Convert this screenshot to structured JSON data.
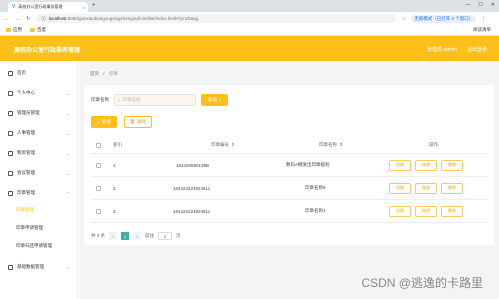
{
  "browser": {
    "tab_title": "高校办公室行政事务管理",
    "url_host": "localhost",
    "url_path": ":8080/gaoxiaobangongxingzheng/admin/dist/index.html#/yinzhang",
    "profile": "无痕模式（已打开 2 个窗口）",
    "bookmarks": [
      "应用",
      "百度"
    ],
    "bookmarks_right": "阅读清单"
  },
  "header": {
    "title": "高校办公室行政事务管理",
    "user": "管理员 admin",
    "logout": "退出登录"
  },
  "sidebar": {
    "items": [
      {
        "label": "首页"
      },
      {
        "label": "个人中心"
      },
      {
        "label": "管理员管理"
      },
      {
        "label": "人事管理"
      },
      {
        "label": "物资管理"
      },
      {
        "label": "会议管理"
      },
      {
        "label": "印章管理"
      },
      {
        "label": "基础数据管理"
      }
    ],
    "subitems": [
      {
        "label": "印章管理",
        "active": true
      },
      {
        "label": "印章申请管理",
        "active": false
      },
      {
        "label": "印章归还申请管理",
        "active": false
      }
    ]
  },
  "breadcrumb": {
    "home": "首页",
    "sep": "/",
    "current": "印章"
  },
  "search": {
    "label": "印章名称",
    "placeholder": "印章名称",
    "button": "查询"
  },
  "toolbar": {
    "add": "新增",
    "delete": "删除"
  },
  "table": {
    "headers": [
      "索引",
      "印章编号",
      "印章名称",
      "操作"
    ],
    "rows": [
      {
        "index": "1",
        "code": "164420680139B",
        "name": "数码A棚发出印章级别"
      },
      {
        "index": "2",
        "code": "164424224924611",
        "name": "印章名称9"
      },
      {
        "index": "3",
        "code": "164424224924611",
        "name": "印章名称1"
      }
    ],
    "actions": [
      "详情",
      "修改",
      "删除"
    ]
  },
  "pager": {
    "total": "共 3 条",
    "prev": "<",
    "page": "1",
    "next": ">",
    "goto": "前往",
    "goto_value": "1",
    "unit": "页"
  },
  "watermark": "CSDN @逃逸的卡路里",
  "colors": {
    "accent": "#fdbf19",
    "page_active": "#3bb3a4"
  }
}
